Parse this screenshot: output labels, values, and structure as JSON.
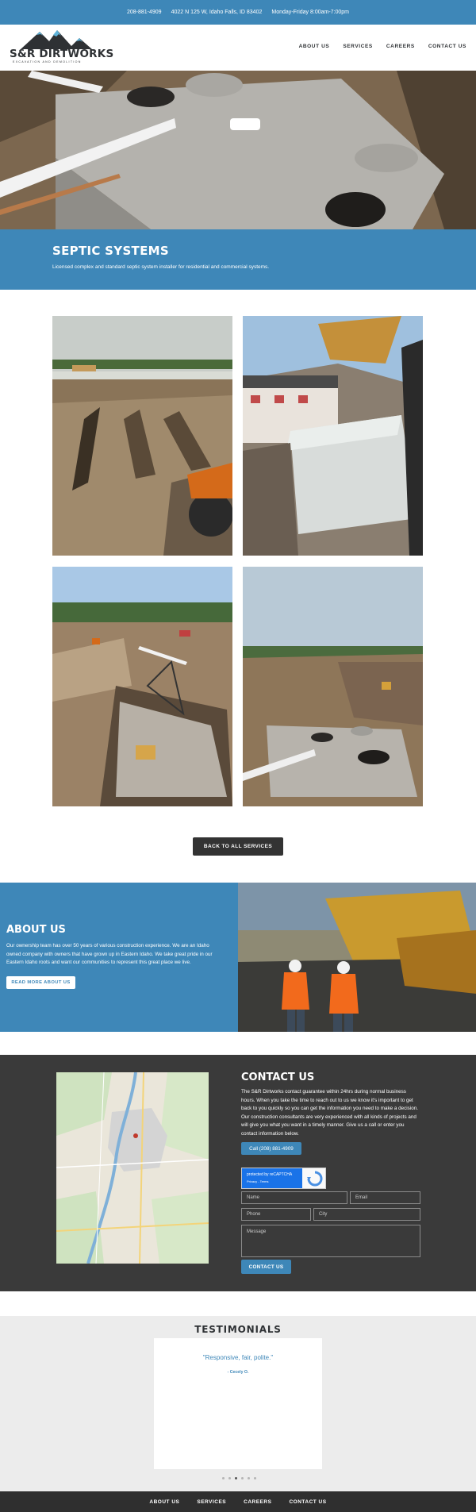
{
  "topbar": {
    "phone": "208-881-4909",
    "address": "4022 N 125 W, Idaho Falls, ID 83402",
    "hours": "Monday-Friday 8:00am-7:00pm"
  },
  "logo": {
    "name": "S&R DIRTWORKS",
    "tagline": "EXCAVATION AND DEMOLITION"
  },
  "nav": [
    "ABOUT US",
    "SERVICES",
    "CAREERS",
    "CONTACT US"
  ],
  "banner": {
    "title": "SEPTIC SYSTEMS",
    "subtitle": "Licensed complex and standard septic system installer for residential and commercial systems."
  },
  "back_button": "BACK TO ALL SERVICES",
  "about": {
    "title": "ABOUT US",
    "body": "Our ownership team has over 50 years of various construction experience. We are an Idaho owned company with owners that have grown up in Eastern Idaho. We take great pride in our Eastern Idaho roots and want our communities to represent this great place we live.",
    "button": "READ MORE ABOUT US"
  },
  "contact": {
    "title": "CONTACT US",
    "body": "The S&R Dirtworks contact guarantee within 24hrs during normal business hours. When you take the time to reach out to us we know it's important to get back to you quickly so you can get the information you need to make a decision. Our construction consultants are very experienced with all kinds of projects and will give you what you want in a timely manner. Give us a call or enter you contact information below.",
    "call_button": "Call (208) 881-4909",
    "recaptcha_line1": "protected by reCAPTCHA",
    "recaptcha_line2": "Privacy - Terms",
    "fields": {
      "name": "Name",
      "email": "Email",
      "phone": "Phone",
      "city": "City",
      "message": "Message"
    },
    "submit": "CONTACT US"
  },
  "testimonials": {
    "title": "TESTIMONIALS",
    "quote": "\"Responsive, fair, polite.\"",
    "author": "- Cecely O.",
    "slide_count": 6,
    "active_slide": 3
  },
  "footer_nav": [
    "ABOUT US",
    "SERVICES",
    "CAREERS",
    "CONTACT US"
  ],
  "colors": {
    "brand_blue": "#3e87b8",
    "dark": "#3a3a3a",
    "footer": "#2f2f2f"
  }
}
